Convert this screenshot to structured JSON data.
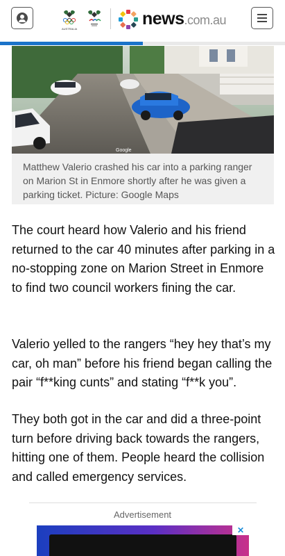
{
  "header": {
    "brand_main": "news",
    "brand_sub": ".com.au",
    "crest1_label": "AUSTRALIA",
    "logo_dot_colors": [
      "#e63946",
      "#f4a261",
      "#2a9d8f",
      "#264653",
      "#8e44ad",
      "#e76f51",
      "#1d9bd7",
      "#f1c40f"
    ],
    "accent_color": "#1a73c9"
  },
  "reading_progress": 0.5,
  "image": {
    "credit": "Google"
  },
  "caption": "Matthew Valerio crashed his car into a parking ranger on Marion St in Enmore shortly after he was given a parking ticket. Picture: Google Maps",
  "paragraphs": [
    "The court heard how Valerio and his friend returned to the car 40 minutes after parking in a no-stopping zone on Marion Street in Enmore to find two council workers fining the car.",
    "Valerio yelled to the rangers “hey hey that’s my car, oh man” before his friend began calling the pair “f**king cunts” and stating “f**k you”.",
    "They both got in the car and did a three-point turn before driving back towards the rangers, hitting one of them. People heard the collision and called emergency services."
  ],
  "ad": {
    "label": "Advertisement",
    "close_glyph": "✕"
  }
}
